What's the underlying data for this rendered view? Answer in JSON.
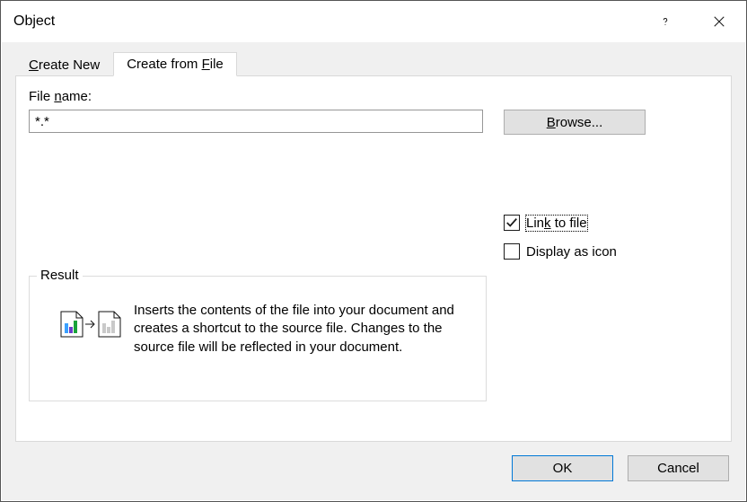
{
  "title": "Object",
  "tabs": {
    "create_new": "Create New",
    "create_from_file": "Create from File"
  },
  "labels": {
    "file_name": "File name:",
    "browse": "Browse...",
    "link_to_file": "Link to file",
    "display_as_icon": "Display as icon",
    "result_legend": "Result"
  },
  "input": {
    "file_value": "*.*"
  },
  "checkboxes": {
    "link_to_file_checked": true,
    "display_as_icon_checked": false
  },
  "result_text": "Inserts the contents of the file into your document and creates a shortcut to the source file.  Changes to the source file will be reflected in your document.",
  "buttons": {
    "ok": "OK",
    "cancel": "Cancel"
  }
}
